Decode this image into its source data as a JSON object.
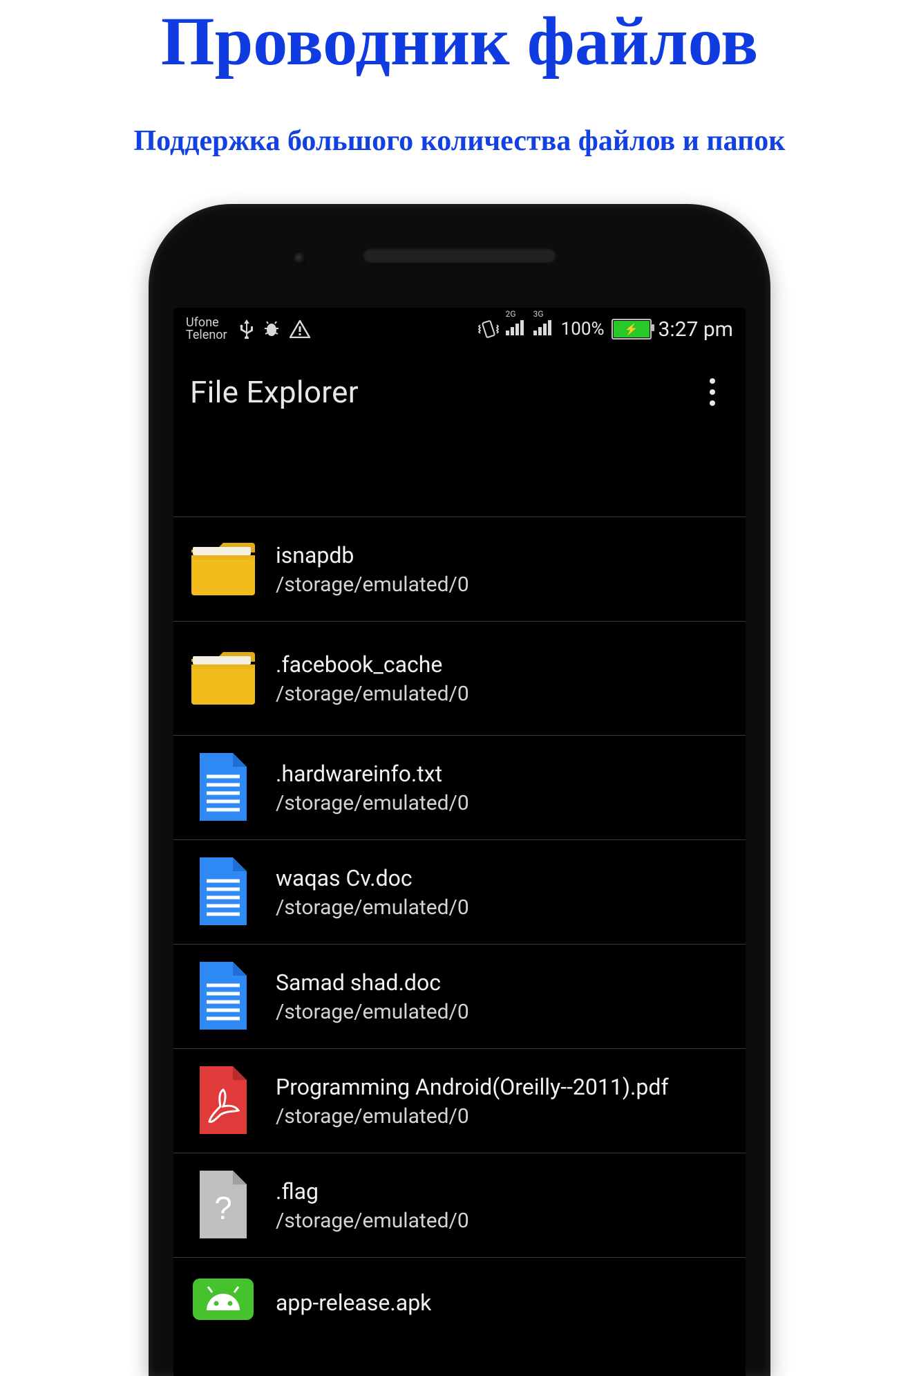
{
  "promo": {
    "title": "Проводник файлов",
    "subtitle": "Поддержка большого количества файлов и папок"
  },
  "status": {
    "carrier1": "Ufone",
    "carrier2": "Telenor",
    "sig1_label": "2G",
    "sig2_label": "3G",
    "battery_pct": "100%",
    "time": "3:27 pm"
  },
  "app": {
    "title": "File Explorer"
  },
  "files": [
    {
      "name": "isnapdb",
      "path": "/storage/emulated/0",
      "icon": "folder"
    },
    {
      "name": ".facebook_cache",
      "path": "/storage/emulated/0",
      "icon": "folder"
    },
    {
      "name": ".hardwareinfo.txt",
      "path": "/storage/emulated/0",
      "icon": "doc"
    },
    {
      "name": "waqas Cv.doc",
      "path": "/storage/emulated/0",
      "icon": "doc"
    },
    {
      "name": "Samad shad.doc",
      "path": "/storage/emulated/0",
      "icon": "doc"
    },
    {
      "name": "Programming Android(Oreilly--2011).pdf",
      "path": "/storage/emulated/0",
      "icon": "pdf"
    },
    {
      "name": ".flag",
      "path": "/storage/emulated/0",
      "icon": "unknown"
    },
    {
      "name": "app-release.apk",
      "path": "",
      "icon": "apk"
    }
  ]
}
